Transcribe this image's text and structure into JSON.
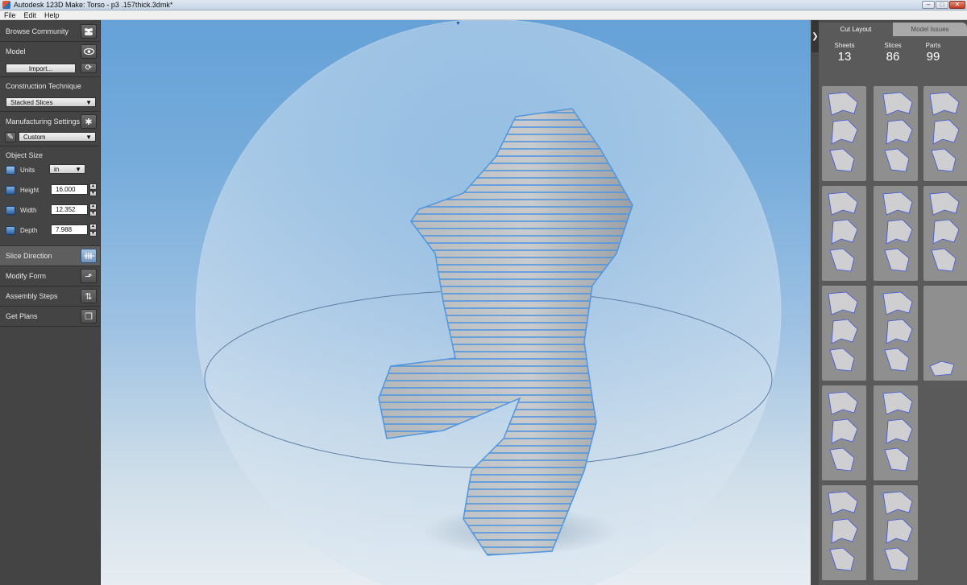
{
  "window": {
    "title": "Autodesk 123D Make: Torso - p3 .157thick.3dmk*"
  },
  "menu": [
    "File",
    "Edit",
    "Help"
  ],
  "left_panel": {
    "browse_community": "Browse Community",
    "model": {
      "label": "Model",
      "import_button": "Import..."
    },
    "construction": {
      "label": "Construction Technique",
      "value": "Stacked Slices"
    },
    "manufacturing": {
      "label": "Manufacturing Settings",
      "value": "Custom"
    },
    "object_size": {
      "label": "Object Size",
      "units_label": "Units",
      "units_value": "in",
      "height_label": "Height",
      "height_value": "16.000",
      "width_label": "Width",
      "width_value": "12.352",
      "depth_label": "Depth",
      "depth_value": "7.988"
    },
    "nav": {
      "slice_direction": "Slice Direction",
      "modify_form": "Modify Form",
      "assembly_steps": "Assembly Steps",
      "get_plans": "Get Plans"
    }
  },
  "right_panel": {
    "tabs": {
      "cut_layout": "Cut Layout",
      "model_issues": "Model Issues"
    },
    "stats": {
      "sheets_label": "Sheets",
      "sheets_value": "13",
      "slices_label": "Slices",
      "slices_value": "86",
      "parts_label": "Parts",
      "parts_value": "99"
    }
  },
  "colors": {
    "viewport_top": "#65a1d8",
    "slice_outline": "#4f96e0",
    "part_label": "#e4523b"
  }
}
